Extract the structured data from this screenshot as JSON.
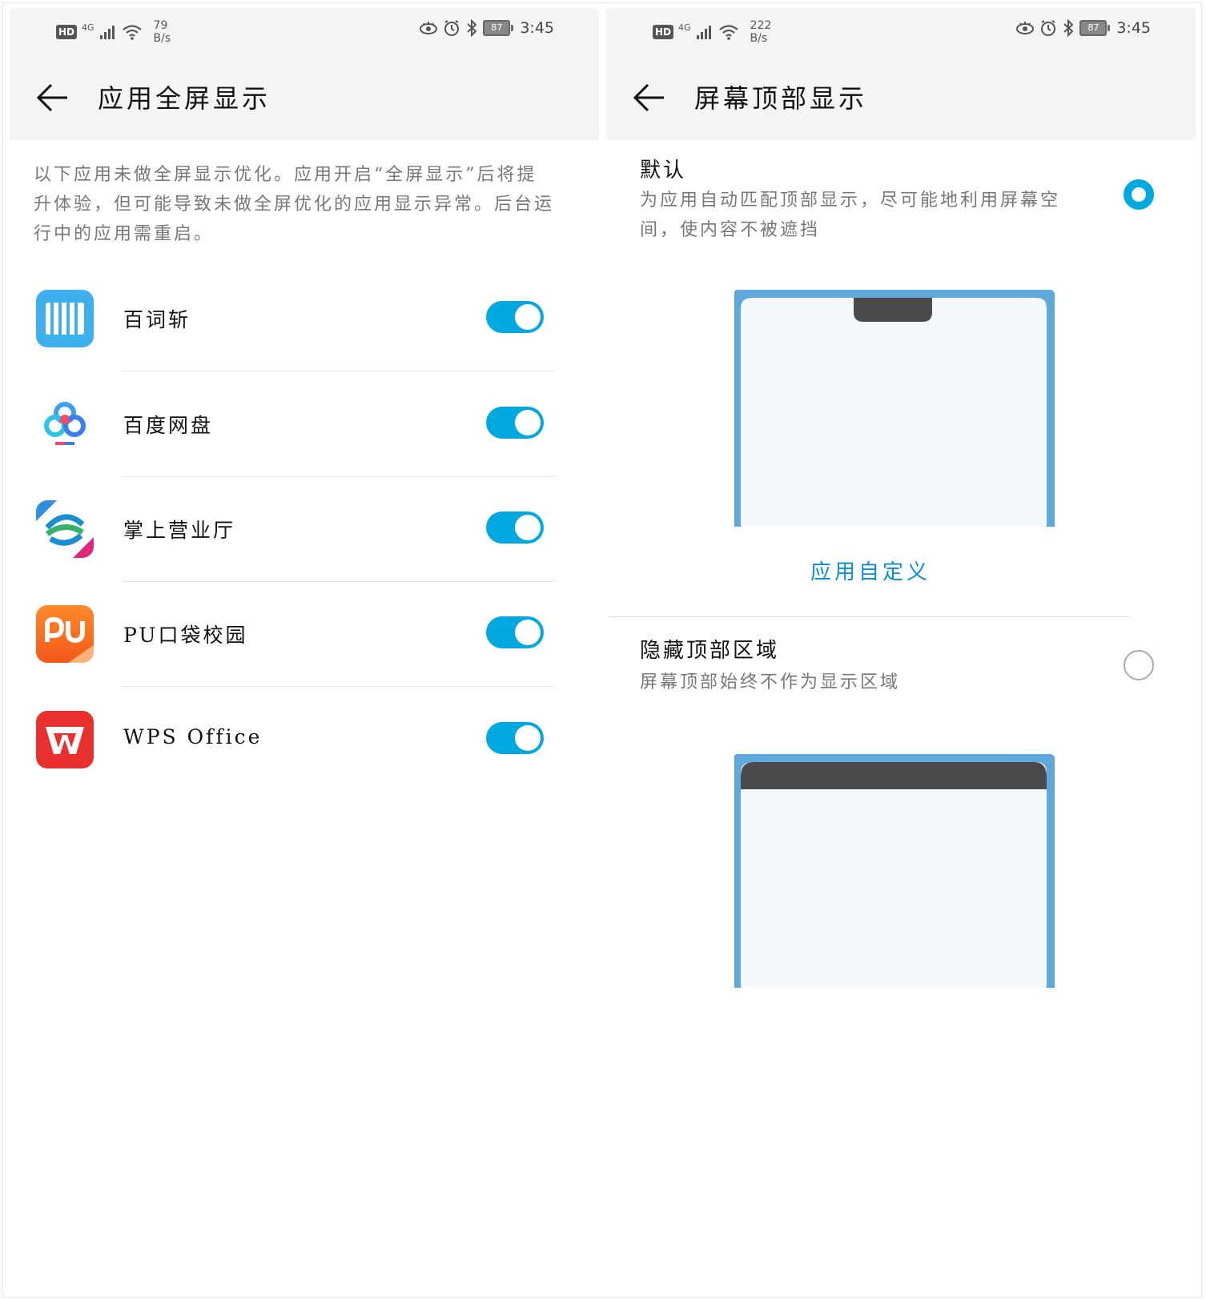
{
  "left": {
    "status": {
      "net": "4G",
      "speed_value": "79",
      "speed_unit": "B/s",
      "battery": "87",
      "time": "3:45"
    },
    "title": "应用全屏显示",
    "description": "以下应用未做全屏显示优化。应用开启“全屏显示”后将提升体验，但可能导致未做全屏优化的应用显示异常。后台运行中的应用需重启。",
    "apps": [
      {
        "name": "百词斩",
        "enabled": true,
        "icon": "baicizhan-icon"
      },
      {
        "name": "百度网盘",
        "enabled": true,
        "icon": "baidu-netdisk-icon"
      },
      {
        "name": "掌上营业厅",
        "enabled": true,
        "icon": "china-mobile-icon"
      },
      {
        "name": "PU口袋校园",
        "enabled": true,
        "icon": "pu-campus-icon"
      },
      {
        "name": "WPS Office",
        "enabled": true,
        "icon": "wps-office-icon"
      }
    ]
  },
  "right": {
    "status": {
      "net": "4G",
      "speed_value": "222",
      "speed_unit": "B/s",
      "battery": "87",
      "time": "3:45"
    },
    "title": "屏幕顶部显示",
    "options": [
      {
        "title": "默认",
        "description": "为应用自动匹配顶部显示，尽可能地利用屏幕空间，使内容不被遮挡",
        "selected": true
      },
      {
        "title": "隐藏顶部区域",
        "description": "屏幕顶部始终不作为显示区域",
        "selected": false
      }
    ],
    "custom_link": "应用自定义"
  },
  "colors": {
    "accent": "#00a8e0",
    "phone_frame": "#5fa8dc",
    "phone_screen": "#f3f8fd",
    "notch": "#4a4a4a"
  }
}
